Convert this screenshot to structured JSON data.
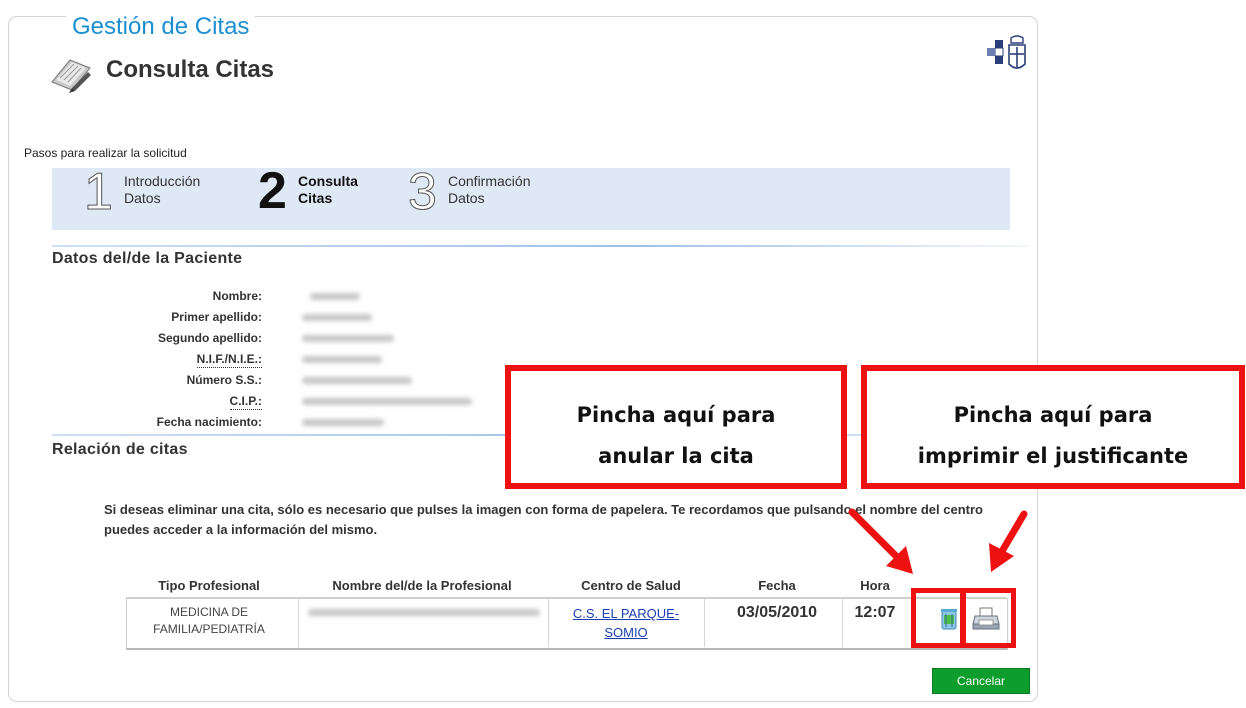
{
  "section_legend": "Gestión de Citas",
  "page_title": "Consulta Citas",
  "steps_intro": "Pasos para realizar la solicitud",
  "steps": [
    {
      "number": "1",
      "line1": "Introducción",
      "line2": "Datos",
      "active": false
    },
    {
      "number": "2",
      "line1": "Consulta",
      "line2": "Citas",
      "active": true
    },
    {
      "number": "3",
      "line1": "Confirmación",
      "line2": "Datos",
      "active": false
    }
  ],
  "patient": {
    "heading": "Datos del/de la Paciente",
    "fields": [
      {
        "label": "Nombre:"
      },
      {
        "label": "Primer apellido:"
      },
      {
        "label": "Segundo apellido:"
      },
      {
        "label": "N.I.F./N.I.E.:"
      },
      {
        "label": "Número S.S.:"
      },
      {
        "label": "C.I.P.:"
      },
      {
        "label": "Fecha nacimiento:"
      }
    ]
  },
  "appointments": {
    "heading": "Relación de citas",
    "notice": "Si deseas eliminar una cita, sólo es necesario que pulses la imagen con forma de papelera. Te recordamos que pulsando el nombre del centro puedes acceder a la información del mismo.",
    "columns": [
      "Tipo Profesional",
      "Nombre del/de la Profesional",
      "Centro de Salud",
      "Fecha",
      "Hora"
    ],
    "rows": [
      {
        "tipo": "MEDICINA DE FAMILIA/PEDIATRÍA",
        "centro": "C.S. EL PARQUE-SOMIO",
        "fecha": "03/05/2010",
        "hora": "12:07"
      }
    ]
  },
  "cancel_label": "Cancelar",
  "callouts": {
    "anular_line1": "Pincha aquí para",
    "anular_line2": "anular la cita",
    "imprimir_line1": "Pincha aquí para",
    "imprimir_line2": "imprimir el justificante"
  },
  "icons": {
    "page": "document-pen-icon",
    "emblem": "asturias-coat-of-arms-icon",
    "delete": "trash-bin-icon",
    "print": "printer-icon"
  },
  "colors": {
    "legend_blue": "#1b8fd1",
    "steps_bg": "#dfe9f5",
    "link": "#1a3fb3",
    "cancel_green": "#0c9d2c",
    "callout_red": "#ee1111"
  }
}
